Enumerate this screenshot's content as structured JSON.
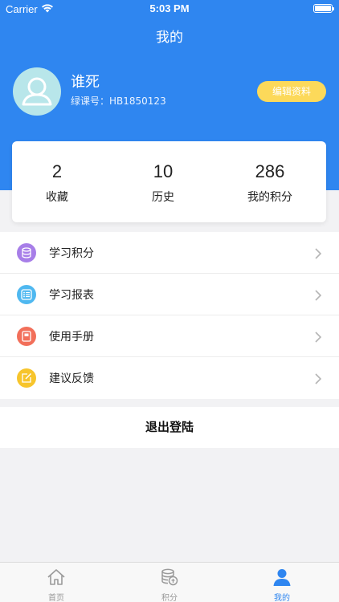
{
  "status_bar": {
    "carrier": "Carrier",
    "time": "5:03 PM"
  },
  "nav": {
    "title": "我的"
  },
  "profile": {
    "name": "谁死",
    "id_text": "绿课号：HB1850123",
    "edit_label": "编辑资料"
  },
  "stats": [
    {
      "value": "2",
      "label": "收藏"
    },
    {
      "value": "10",
      "label": "历史"
    },
    {
      "value": "286",
      "label": "我的积分"
    }
  ],
  "menu": [
    {
      "label": "学习积分",
      "icon": "coins-icon",
      "color": "#a77ee8"
    },
    {
      "label": "学习报表",
      "icon": "list-icon",
      "color": "#4fb8f0"
    },
    {
      "label": "使用手册",
      "icon": "book-icon",
      "color": "#f26f5a"
    },
    {
      "label": "建议反馈",
      "icon": "edit-icon",
      "color": "#f7c52c"
    }
  ],
  "logout_label": "退出登陆",
  "tabs": [
    {
      "label": "首页",
      "icon": "home-icon"
    },
    {
      "label": "积分",
      "icon": "coins-icon"
    },
    {
      "label": "我的",
      "icon": "user-icon"
    }
  ],
  "colors": {
    "brand": "#2f86f0",
    "edit_button": "#fcd95a",
    "tab_active": "#2f86f0",
    "tab_inactive": "#999999"
  }
}
